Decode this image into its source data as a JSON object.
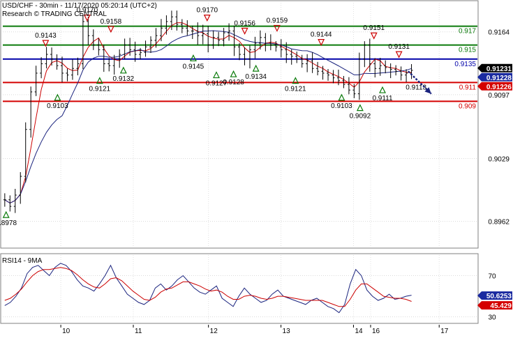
{
  "window": {
    "header_line1": "USD/CHF - 30min - 11/17/2020 05:20:14 (UTC+2)",
    "header_line2": "Research © TRADING CENTRAL"
  },
  "colors": {
    "background": "#ffffff",
    "panel_border": "#7f7f7f",
    "price_bars": "#000000",
    "ma_fast": "#cc0000",
    "ma_slow": "#1a237e",
    "support_resistance_green": "#0a7a0a",
    "pivot_blue": "#0000aa",
    "support_red": "#d40000",
    "forecast_arrow": "#1a237e",
    "last_price_tag": "#000000",
    "blue_tag": "#1a2aa0",
    "red_tag": "#d40000",
    "rsi_line": "#1a237e",
    "rsi_ma_line": "#cc0000",
    "rsi_tag_blue": "#1a2aa0",
    "rsi_tag_red": "#d40000",
    "marker_up": "#0a7a0a",
    "marker_down": "#cc0000"
  },
  "chart_data": [
    {
      "type": "candlestick",
      "title": "USD/CHF - 30min - 11/17/2020 05:20:14 (UTC+2)",
      "ylim": [
        0.8935,
        0.9195
      ],
      "y_ticks": [
        0.8962,
        0.9029,
        0.9097,
        0.9164
      ],
      "x_ticks": [
        "10",
        "11",
        "12",
        "13",
        "14",
        "16",
        "17"
      ],
      "grid": true,
      "last_price": "0.91231",
      "tags": [
        {
          "label": "0.91228",
          "value": 0.91228,
          "style": "blue"
        },
        {
          "label": "0.91226",
          "value": 0.91226,
          "style": "red"
        }
      ],
      "levels": [
        {
          "value": 0.917,
          "label": "0.917",
          "color": "green"
        },
        {
          "value": 0.915,
          "label": "0.915",
          "color": "green"
        },
        {
          "value": 0.9135,
          "label": "0.9135",
          "color": "blue"
        },
        {
          "value": 0.911,
          "label": "0.911",
          "color": "red"
        },
        {
          "value": 0.909,
          "label": "0.909",
          "color": "red"
        }
      ],
      "annotations": [
        {
          "x": 0.5,
          "y": 0.8978,
          "text": "0.8978",
          "marker": "up"
        },
        {
          "x": 6.5,
          "y": 0.9143,
          "text": "0.9143",
          "marker": "down"
        },
        {
          "x": 8.3,
          "y": 0.9103,
          "text": "0.9103",
          "marker": "up"
        },
        {
          "x": 12.8,
          "y": 0.917,
          "text": "0.9170",
          "marker": "down"
        },
        {
          "x": 14.7,
          "y": 0.9121,
          "text": "0.9121",
          "marker": "up"
        },
        {
          "x": 16.4,
          "y": 0.9158,
          "text": "0.9158",
          "marker": "down"
        },
        {
          "x": 18.3,
          "y": 0.9132,
          "text": "0.9132",
          "marker": "up"
        },
        {
          "x": 31.0,
          "y": 0.917,
          "text": "0.9170",
          "marker": "down"
        },
        {
          "x": 28.9,
          "y": 0.9145,
          "text": "0.9145",
          "marker": "up"
        },
        {
          "x": 32.4,
          "y": 0.9127,
          "text": "0.9127",
          "marker": "up"
        },
        {
          "x": 35.0,
          "y": 0.9128,
          "text": "0.9128",
          "marker": "up"
        },
        {
          "x": 36.7,
          "y": 0.9156,
          "text": "0.9156",
          "marker": "down"
        },
        {
          "x": 38.4,
          "y": 0.9134,
          "text": "0.9134",
          "marker": "up"
        },
        {
          "x": 41.6,
          "y": 0.9159,
          "text": "0.9159",
          "marker": "down"
        },
        {
          "x": 44.4,
          "y": 0.9121,
          "text": "0.9121",
          "marker": "up"
        },
        {
          "x": 48.3,
          "y": 0.9144,
          "text": "0.9144",
          "marker": "down"
        },
        {
          "x": 51.4,
          "y": 0.9103,
          "text": "0.9103",
          "marker": "up"
        },
        {
          "x": 54.2,
          "y": 0.9092,
          "text": "0.9092",
          "marker": "up"
        },
        {
          "x": 56.3,
          "y": 0.9151,
          "text": "0.9151",
          "marker": "down"
        },
        {
          "x": 57.6,
          "y": 0.9111,
          "text": "0.9111",
          "marker": "up"
        },
        {
          "x": 60.1,
          "y": 0.9131,
          "text": "0.9131",
          "marker": "down"
        },
        {
          "x": 62.7,
          "y": 0.9113,
          "text": "0.9113",
          "marker": "none"
        }
      ],
      "forecast": {
        "from": [
          61.5,
          0.9122
        ],
        "to": [
          65.0,
          0.9098
        ]
      },
      "x_range": [
        0,
        72
      ],
      "closes": [
        0.8985,
        0.8978,
        0.899,
        0.901,
        0.906,
        0.91,
        0.912,
        0.913,
        0.914,
        0.9135,
        0.9128,
        0.912,
        0.9118,
        0.9125,
        0.913,
        0.9175,
        0.916,
        0.915,
        0.9145,
        0.913,
        0.9128,
        0.9135,
        0.914,
        0.915,
        0.9145,
        0.914,
        0.9142,
        0.9148,
        0.9155,
        0.916,
        0.9168,
        0.9175,
        0.918,
        0.9172,
        0.9168,
        0.9165,
        0.9165,
        0.916,
        0.9162,
        0.915,
        0.9158,
        0.9155,
        0.9163,
        0.9165,
        0.9148,
        0.914,
        0.9135,
        0.9145,
        0.9152,
        0.9158,
        0.9152,
        0.915,
        0.9148,
        0.9145,
        0.914,
        0.9138,
        0.9135,
        0.913,
        0.9133,
        0.9125,
        0.9122,
        0.912,
        0.9118,
        0.9115,
        0.9112,
        0.9108,
        0.9102,
        0.9098,
        0.9135,
        0.915,
        0.913,
        0.9125,
        0.9128,
        0.9126,
        0.9124,
        0.9122,
        0.9118,
        0.912,
        0.9123
      ]
    },
    {
      "type": "line",
      "title": "RSI14 - 9MA",
      "ylim": [
        25,
        90
      ],
      "y_ticks": [
        30,
        70
      ],
      "tags": [
        {
          "label": "50.6253",
          "value": 50.6253,
          "style": "blue"
        },
        {
          "label": "45.429",
          "value": 45.429,
          "style": "red"
        }
      ],
      "series": [
        {
          "name": "RSI14",
          "values": [
            41,
            44,
            50,
            58,
            72,
            78,
            80,
            75,
            70,
            78,
            82,
            80,
            74,
            66,
            60,
            58,
            55,
            62,
            70,
            80,
            68,
            60,
            52,
            48,
            44,
            42,
            46,
            58,
            62,
            56,
            60,
            66,
            70,
            64,
            58,
            54,
            52,
            56,
            60,
            48,
            44,
            40,
            50,
            58,
            52,
            48,
            44,
            46,
            52,
            56,
            50,
            48,
            46,
            44,
            42,
            46,
            48,
            44,
            40,
            38,
            34,
            42,
            62,
            76,
            70,
            56,
            50,
            46,
            48,
            52,
            47,
            48,
            50,
            51
          ]
        },
        {
          "name": "9MA",
          "values": [
            46,
            48,
            52,
            57,
            64,
            70,
            74,
            76,
            76,
            77,
            78,
            77,
            75,
            71,
            66,
            62,
            59,
            58,
            62,
            67,
            68,
            65,
            60,
            55,
            51,
            47,
            46,
            49,
            54,
            57,
            58,
            61,
            64,
            64,
            62,
            60,
            57,
            55,
            56,
            54,
            50,
            47,
            47,
            50,
            51,
            50,
            48,
            47,
            48,
            50,
            50,
            49,
            48,
            47,
            46,
            46,
            46,
            46,
            44,
            42,
            40,
            40,
            47,
            56,
            62,
            62,
            58,
            54,
            50,
            49,
            48,
            48,
            47,
            45
          ]
        }
      ]
    }
  ]
}
